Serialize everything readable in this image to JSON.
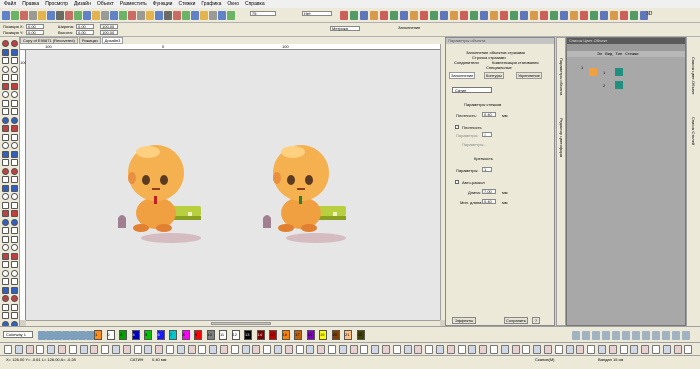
{
  "menu": [
    "Файл",
    "Правка",
    "Просмотр",
    "Дизайн",
    "Объект",
    "Разместить",
    "Функции",
    "Стежки",
    "Графика",
    "Окно",
    "Справка"
  ],
  "toolbar": {
    "zoom_value": "75",
    "mode_value": "Нет",
    "three_d_label": "3D"
  },
  "position_panel": {
    "pos_x_label": "Позиция X:",
    "pos_x_value": "0.00",
    "pos_y_label": "Позиция Y:",
    "pos_y_value": "0.00",
    "width_label": "Ширина:",
    "width_value": "0.00",
    "height_label": "Высота:",
    "height_value": "0.00",
    "w_pct": "100.00",
    "h_pct": "100.00",
    "unit_select": "Метрика",
    "apply_label": "Заполнение"
  },
  "doc_tabs": [
    "Copy of E90871 (Recovered)",
    "Рожицки",
    "Дизайн3"
  ],
  "ruler": {
    "h_ticks": [
      "100",
      "0",
      "100"
    ],
    "v_ticks": [
      "100"
    ]
  },
  "props": {
    "title": "Параметры объекта",
    "menu_items": [
      "Заполнение объектов стразами",
      "Строчка стразами",
      "Соединители",
      "Компенсация стягивания",
      "Специальные"
    ],
    "tabs": [
      "Заполнение",
      "Контуры",
      "Укрепление"
    ],
    "fill_type": "Сатин",
    "stitch_params_label": "Параметры стежков",
    "density_label": "Плотность:",
    "density_value": "0.40",
    "density_unit": "мм",
    "density_check_label": "Плотность",
    "params_label": "Параметры:",
    "params_value": "0",
    "params_btn": "Параметры...",
    "strength_label": "Крепкость",
    "strength_params_label": "Параметры:",
    "strength_value": "1",
    "auto_split_label": "Авто-раскол",
    "length_label": "Длина:",
    "length_value": "7.00",
    "min_length_label": "Мин. длина:",
    "min_length_value": "0.40",
    "unit_mm": "мм",
    "effects_btn": "Эффекты",
    "save_btn": "Сохранить",
    "help_btn": "?"
  },
  "side_tabs": [
    "Параметры объекта",
    "Редактор цветоформ"
  ],
  "objects": {
    "title": "Список Цвет-Объект",
    "columns": [
      "Эл",
      "Вид",
      "Тип",
      "Стежки"
    ],
    "rows": [
      "1",
      "2"
    ]
  },
  "right_tabs": [
    "Список цвет-Объект",
    "Список Стилей"
  ],
  "palette": {
    "name": "Colorway 1",
    "colors": [
      "#ff8c1a",
      "#ffffff",
      "#00a000",
      "#0000c0",
      "#00c000",
      "#1a1aff",
      "#00c8c8",
      "#ff00ff",
      "#ff0000",
      "#808080",
      "#ffffff",
      "#ffffff",
      "#000000",
      "#800000",
      "#c00000",
      "#ff8000",
      "#c06000",
      "#8000c0",
      "#ffff00",
      "#804000",
      "#ffc080",
      "#404000"
    ],
    "numbers": [
      "1",
      "2",
      "3",
      "4",
      "5",
      "6",
      "7",
      "8",
      "9",
      "10",
      "11",
      "12",
      "13",
      "14",
      "15",
      "16",
      "17",
      "18",
      "19",
      "20",
      "21",
      "22"
    ]
  },
  "status": {
    "coords": "X= 126.00 Y= -0.61 L= 126.00 A= -0.28",
    "stitch": "САТИН",
    "stitch_val": "0.40 мм",
    "status_right": "Сканов(М)",
    "hoop": "Вандан 15 см"
  }
}
